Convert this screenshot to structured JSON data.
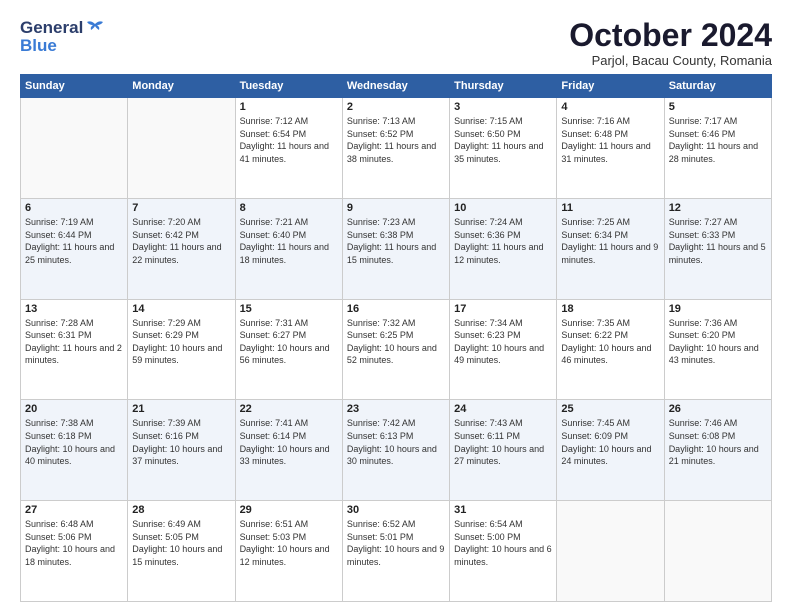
{
  "header": {
    "logo_general": "General",
    "logo_blue": "Blue",
    "month": "October 2024",
    "location": "Parjol, Bacau County, Romania"
  },
  "days_of_week": [
    "Sunday",
    "Monday",
    "Tuesday",
    "Wednesday",
    "Thursday",
    "Friday",
    "Saturday"
  ],
  "weeks": [
    [
      {
        "num": "",
        "info": ""
      },
      {
        "num": "",
        "info": ""
      },
      {
        "num": "1",
        "info": "Sunrise: 7:12 AM\nSunset: 6:54 PM\nDaylight: 11 hours and 41 minutes."
      },
      {
        "num": "2",
        "info": "Sunrise: 7:13 AM\nSunset: 6:52 PM\nDaylight: 11 hours and 38 minutes."
      },
      {
        "num": "3",
        "info": "Sunrise: 7:15 AM\nSunset: 6:50 PM\nDaylight: 11 hours and 35 minutes."
      },
      {
        "num": "4",
        "info": "Sunrise: 7:16 AM\nSunset: 6:48 PM\nDaylight: 11 hours and 31 minutes."
      },
      {
        "num": "5",
        "info": "Sunrise: 7:17 AM\nSunset: 6:46 PM\nDaylight: 11 hours and 28 minutes."
      }
    ],
    [
      {
        "num": "6",
        "info": "Sunrise: 7:19 AM\nSunset: 6:44 PM\nDaylight: 11 hours and 25 minutes."
      },
      {
        "num": "7",
        "info": "Sunrise: 7:20 AM\nSunset: 6:42 PM\nDaylight: 11 hours and 22 minutes."
      },
      {
        "num": "8",
        "info": "Sunrise: 7:21 AM\nSunset: 6:40 PM\nDaylight: 11 hours and 18 minutes."
      },
      {
        "num": "9",
        "info": "Sunrise: 7:23 AM\nSunset: 6:38 PM\nDaylight: 11 hours and 15 minutes."
      },
      {
        "num": "10",
        "info": "Sunrise: 7:24 AM\nSunset: 6:36 PM\nDaylight: 11 hours and 12 minutes."
      },
      {
        "num": "11",
        "info": "Sunrise: 7:25 AM\nSunset: 6:34 PM\nDaylight: 11 hours and 9 minutes."
      },
      {
        "num": "12",
        "info": "Sunrise: 7:27 AM\nSunset: 6:33 PM\nDaylight: 11 hours and 5 minutes."
      }
    ],
    [
      {
        "num": "13",
        "info": "Sunrise: 7:28 AM\nSunset: 6:31 PM\nDaylight: 11 hours and 2 minutes."
      },
      {
        "num": "14",
        "info": "Sunrise: 7:29 AM\nSunset: 6:29 PM\nDaylight: 10 hours and 59 minutes."
      },
      {
        "num": "15",
        "info": "Sunrise: 7:31 AM\nSunset: 6:27 PM\nDaylight: 10 hours and 56 minutes."
      },
      {
        "num": "16",
        "info": "Sunrise: 7:32 AM\nSunset: 6:25 PM\nDaylight: 10 hours and 52 minutes."
      },
      {
        "num": "17",
        "info": "Sunrise: 7:34 AM\nSunset: 6:23 PM\nDaylight: 10 hours and 49 minutes."
      },
      {
        "num": "18",
        "info": "Sunrise: 7:35 AM\nSunset: 6:22 PM\nDaylight: 10 hours and 46 minutes."
      },
      {
        "num": "19",
        "info": "Sunrise: 7:36 AM\nSunset: 6:20 PM\nDaylight: 10 hours and 43 minutes."
      }
    ],
    [
      {
        "num": "20",
        "info": "Sunrise: 7:38 AM\nSunset: 6:18 PM\nDaylight: 10 hours and 40 minutes."
      },
      {
        "num": "21",
        "info": "Sunrise: 7:39 AM\nSunset: 6:16 PM\nDaylight: 10 hours and 37 minutes."
      },
      {
        "num": "22",
        "info": "Sunrise: 7:41 AM\nSunset: 6:14 PM\nDaylight: 10 hours and 33 minutes."
      },
      {
        "num": "23",
        "info": "Sunrise: 7:42 AM\nSunset: 6:13 PM\nDaylight: 10 hours and 30 minutes."
      },
      {
        "num": "24",
        "info": "Sunrise: 7:43 AM\nSunset: 6:11 PM\nDaylight: 10 hours and 27 minutes."
      },
      {
        "num": "25",
        "info": "Sunrise: 7:45 AM\nSunset: 6:09 PM\nDaylight: 10 hours and 24 minutes."
      },
      {
        "num": "26",
        "info": "Sunrise: 7:46 AM\nSunset: 6:08 PM\nDaylight: 10 hours and 21 minutes."
      }
    ],
    [
      {
        "num": "27",
        "info": "Sunrise: 6:48 AM\nSunset: 5:06 PM\nDaylight: 10 hours and 18 minutes."
      },
      {
        "num": "28",
        "info": "Sunrise: 6:49 AM\nSunset: 5:05 PM\nDaylight: 10 hours and 15 minutes."
      },
      {
        "num": "29",
        "info": "Sunrise: 6:51 AM\nSunset: 5:03 PM\nDaylight: 10 hours and 12 minutes."
      },
      {
        "num": "30",
        "info": "Sunrise: 6:52 AM\nSunset: 5:01 PM\nDaylight: 10 hours and 9 minutes."
      },
      {
        "num": "31",
        "info": "Sunrise: 6:54 AM\nSunset: 5:00 PM\nDaylight: 10 hours and 6 minutes."
      },
      {
        "num": "",
        "info": ""
      },
      {
        "num": "",
        "info": ""
      }
    ]
  ]
}
